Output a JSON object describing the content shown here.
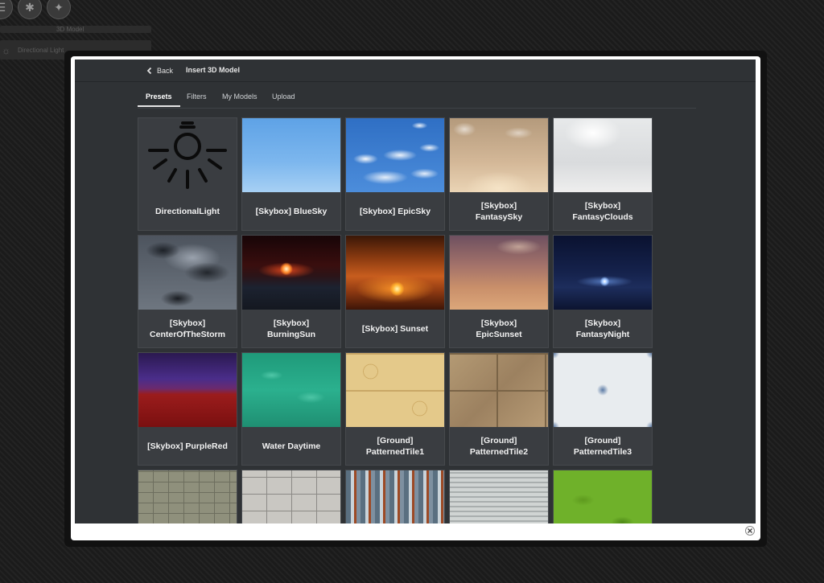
{
  "background_app": {
    "bar1_text": "3D Model",
    "bar2_text": "Directional Light"
  },
  "modal": {
    "back_label": "Back",
    "title": "Insert 3D Model",
    "tabs": [
      {
        "label": "Presets",
        "active": true
      },
      {
        "label": "Filters",
        "active": false
      },
      {
        "label": "My Models",
        "active": false
      },
      {
        "label": "Upload",
        "active": false
      }
    ],
    "items": [
      {
        "label": "DirectionalLight",
        "icon": "lightbulb-icon"
      },
      {
        "label": "[Skybox] BlueSky"
      },
      {
        "label": "[Skybox] EpicSky"
      },
      {
        "label": "[Skybox]\nFantasySky"
      },
      {
        "label": "[Skybox]\nFantasyClouds"
      },
      {
        "label": "[Skybox]\nCenterOfTheStorm"
      },
      {
        "label": "[Skybox]\nBurningSun"
      },
      {
        "label": "[Skybox] Sunset"
      },
      {
        "label": "[Skybox]\nEpicSunset"
      },
      {
        "label": "[Skybox]\nFantasyNight"
      },
      {
        "label": "[Skybox] PurpleRed"
      },
      {
        "label": "Water Daytime"
      },
      {
        "label": "[Ground]\nPatternedTile1"
      },
      {
        "label": "[Ground]\nPatternedTile2"
      },
      {
        "label": "[Ground]\nPatternedTile3"
      }
    ],
    "close_icon": "close-icon"
  }
}
